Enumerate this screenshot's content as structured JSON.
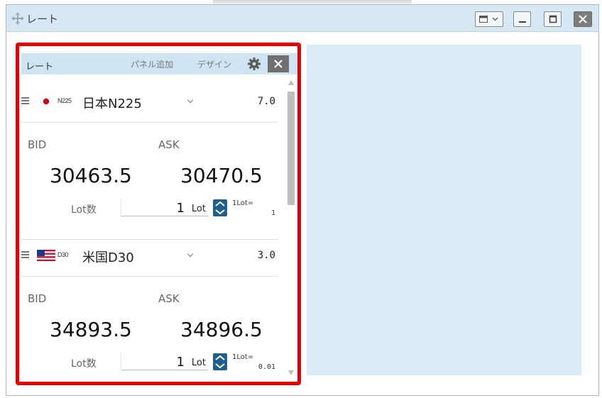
{
  "window": {
    "title": "レート",
    "buttons": {
      "layout": "layout-menu",
      "minimize": "minimize",
      "maximize": "maximize",
      "close": "close"
    }
  },
  "panel": {
    "title": "レート",
    "add_panel_label": "パネル追加",
    "design_label": "デザイン"
  },
  "cards": [
    {
      "flag": "jp-flag-icon",
      "code": "N225",
      "name": "日本N225",
      "spread": "7.0",
      "bid_label": "BID",
      "ask_label": "ASK",
      "bid": "30463.5",
      "ask": "30470.5",
      "lot_label": "Lot数",
      "lot_value": "1",
      "lot_unit": "Lot",
      "lot_size_label": "1Lot=",
      "lot_size_value": "1"
    },
    {
      "flag": "us-flag-icon",
      "code": "D30",
      "name": "米国D30",
      "spread": "3.0",
      "bid_label": "BID",
      "ask_label": "ASK",
      "bid": "34893.5",
      "ask": "34896.5",
      "lot_label": "Lot数",
      "lot_value": "1",
      "lot_unit": "Lot",
      "lot_size_label": "1Lot=",
      "lot_size_value": "0.01"
    }
  ],
  "colors": {
    "highlight_frame": "#e60000",
    "titlebar": "#d6e8f4",
    "stepper": "#1f5f8e",
    "right_panel": "#daecf7"
  }
}
